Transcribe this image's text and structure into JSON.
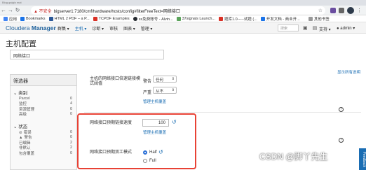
{
  "browser": {
    "tab_hint": "Blog gaiglo mat",
    "insecure_label": "不安全",
    "url": "bigserver1:7180/cmf/hardware/hosts/config#filterFreeText=网络接口",
    "bookmarks": [
      {
        "label": "应用",
        "color": "#4285f4"
      },
      {
        "label": "Bookmarks",
        "color": "#1a73e8"
      },
      {
        "label": "HTML 2 PDF – a P...",
        "color": "#2b5797"
      },
      {
        "label": "TCPDF Examples",
        "color": "#d93025"
      },
      {
        "label": "ss免费账号 - Alvin...",
        "color": "#24292e"
      },
      {
        "label": "37signals Launch...",
        "color": "#5aa35a"
      },
      {
        "label": "题库1.0-----试题 (...",
        "color": "#d93025"
      },
      {
        "label": "开发文档 - 商业开...",
        "color": "#1a73e8"
      },
      {
        "label": "其他书签",
        "color": "#999999"
      }
    ]
  },
  "header": {
    "logo_prefix": "Cloudera",
    "logo_suffix": "Manager",
    "menu": [
      {
        "label": "群集 ▾",
        "active": false
      },
      {
        "label": "主机 ▾",
        "active": true
      },
      {
        "label": "诊断 ▾",
        "active": false
      },
      {
        "label": "审核",
        "active": false
      },
      {
        "label": "图表 ▾",
        "active": false
      },
      {
        "label": "管理 ▾",
        "active": false
      }
    ],
    "search_placeholder": "搜索",
    "support_label": "支持 ▾",
    "user_label": "admin ▾"
  },
  "page": {
    "title": "主机配置",
    "filter_value": "网络接口",
    "desc_toggle": "显示所有说明"
  },
  "sidebar": {
    "title": "筛选器",
    "groups": [
      {
        "label": "类别",
        "rows": [
          {
            "icon": "",
            "label": "Parcel",
            "count": "0"
          },
          {
            "icon": "",
            "label": "监控",
            "count": "4"
          },
          {
            "icon": "",
            "label": "资源管理",
            "count": "0"
          },
          {
            "icon": "",
            "label": "高级",
            "count": "0"
          }
        ]
      },
      {
        "label": "状态",
        "rows": [
          {
            "icon": "⊘",
            "label": "错误",
            "count": "0"
          },
          {
            "icon": "▲",
            "label": "警告",
            "count": "0"
          },
          {
            "icon": "",
            "label": "已编辑",
            "count": "2"
          },
          {
            "icon": "",
            "label": "非默认",
            "count": "2"
          },
          {
            "icon": "",
            "label": "包含覆盖",
            "count": "0"
          }
        ]
      }
    ]
  },
  "props": {
    "p1_label_line1": "主机的网络接口倍速链接模",
    "p1_label_line2": "式阈值",
    "warn_label": "警告",
    "warn_value": "任何",
    "crit_label": "严重",
    "crit_value": "从不",
    "p1_link": "管理主机覆盖",
    "p2_label": "网络接口预期链接速度",
    "p2_value": "100",
    "p2_link": "管理主机覆盖",
    "p3_label": "网络接口预期双工模式",
    "p3_opt1": "Half",
    "p3_opt2": "Full",
    "undo_icon": "↺",
    "help_icon": "?"
  },
  "watermark": "CSDN @脚丫先生",
  "feedback": "Feedback"
}
